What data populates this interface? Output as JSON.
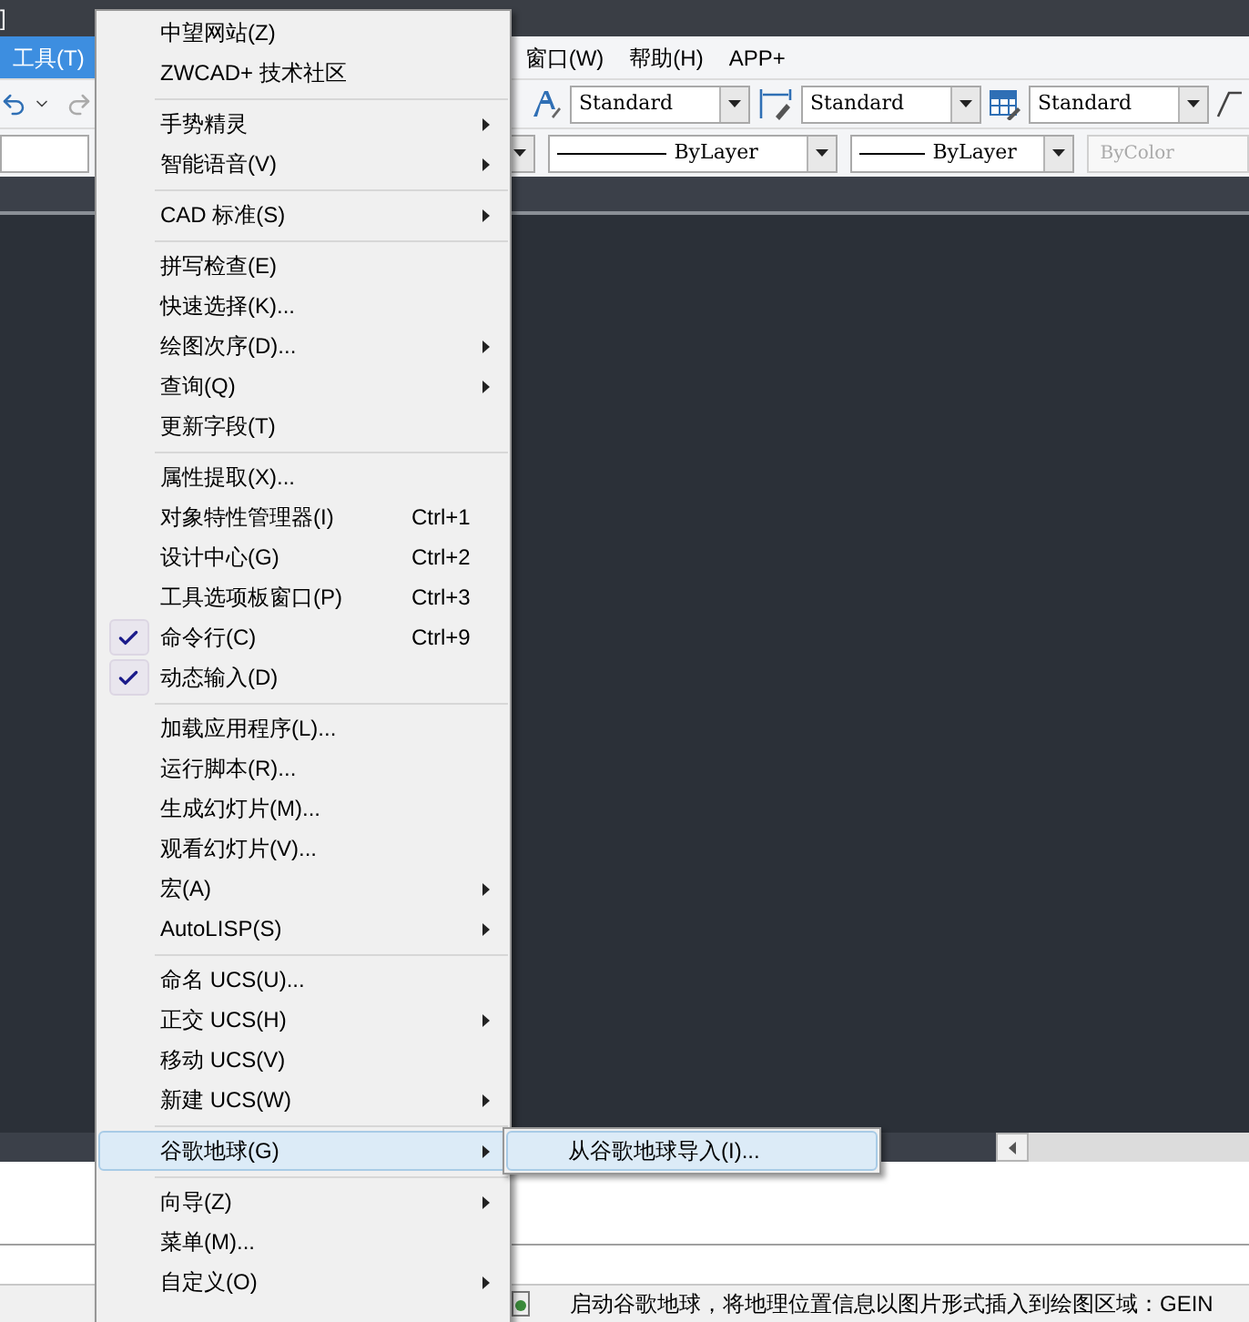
{
  "window": {
    "title": "]"
  },
  "menu_bar": {
    "items": [
      {
        "label": "工具(T)",
        "selected": true
      },
      {
        "label": "窗口(W)",
        "selected": false
      },
      {
        "label": "帮助(H)",
        "selected": false
      },
      {
        "label": "APP+",
        "selected": false
      }
    ]
  },
  "toolbar_1": {
    "combos": [
      {
        "kind": "text-style",
        "value": "Standard"
      },
      {
        "kind": "dimension-style",
        "value": "Standard"
      },
      {
        "kind": "table-style",
        "value": "Standard"
      }
    ]
  },
  "toolbar_2": {
    "combos": [
      {
        "kind": "linetype",
        "value": "ByLayer"
      },
      {
        "kind": "lineweight",
        "value": "ByLayer"
      }
    ],
    "color_field": {
      "value": "ByColor",
      "disabled": true
    }
  },
  "tools_menu": {
    "items": [
      {
        "kind": "item",
        "label": "中望网站(Z)",
        "checked": false,
        "selected": false,
        "submenu": false
      },
      {
        "kind": "item",
        "label": "ZWCAD+ 技术社区",
        "checked": false,
        "selected": false,
        "submenu": false
      },
      {
        "kind": "separator"
      },
      {
        "kind": "item",
        "label": "手势精灵",
        "checked": false,
        "selected": false,
        "submenu": true
      },
      {
        "kind": "item",
        "label": "智能语音(V)",
        "checked": false,
        "selected": false,
        "submenu": true
      },
      {
        "kind": "separator"
      },
      {
        "kind": "item",
        "label": "CAD 标准(S)",
        "checked": false,
        "selected": false,
        "submenu": true
      },
      {
        "kind": "separator"
      },
      {
        "kind": "item",
        "label": "拼写检查(E)",
        "checked": false,
        "selected": false,
        "submenu": false
      },
      {
        "kind": "item",
        "label": "快速选择(K)...",
        "checked": false,
        "selected": false,
        "submenu": false
      },
      {
        "kind": "item",
        "label": "绘图次序(D)...",
        "checked": false,
        "selected": false,
        "submenu": true
      },
      {
        "kind": "item",
        "label": "查询(Q)",
        "checked": false,
        "selected": false,
        "submenu": true
      },
      {
        "kind": "item",
        "label": "更新字段(T)",
        "checked": false,
        "selected": false,
        "submenu": false
      },
      {
        "kind": "separator"
      },
      {
        "kind": "item",
        "label": "属性提取(X)...",
        "checked": false,
        "selected": false,
        "submenu": false
      },
      {
        "kind": "item",
        "label": "对象特性管理器(I)",
        "shortcut": "Ctrl+1",
        "checked": false,
        "selected": false,
        "submenu": false
      },
      {
        "kind": "item",
        "label": "设计中心(G)",
        "shortcut": "Ctrl+2",
        "checked": false,
        "selected": false,
        "submenu": false
      },
      {
        "kind": "item",
        "label": "工具选项板窗口(P)",
        "shortcut": "Ctrl+3",
        "checked": false,
        "selected": false,
        "submenu": false
      },
      {
        "kind": "item",
        "label": "命令行(C)",
        "shortcut": "Ctrl+9",
        "checked": true,
        "selected": false,
        "submenu": false
      },
      {
        "kind": "item",
        "label": "动态输入(D)",
        "checked": true,
        "selected": false,
        "submenu": false
      },
      {
        "kind": "separator"
      },
      {
        "kind": "item",
        "label": "加载应用程序(L)...",
        "checked": false,
        "selected": false,
        "submenu": false
      },
      {
        "kind": "item",
        "label": "运行脚本(R)...",
        "checked": false,
        "selected": false,
        "submenu": false
      },
      {
        "kind": "item",
        "label": "生成幻灯片(M)...",
        "checked": false,
        "selected": false,
        "submenu": false
      },
      {
        "kind": "item",
        "label": "观看幻灯片(V)...",
        "checked": false,
        "selected": false,
        "submenu": false
      },
      {
        "kind": "item",
        "label": "宏(A)",
        "checked": false,
        "selected": false,
        "submenu": true
      },
      {
        "kind": "item",
        "label": "AutoLISP(S)",
        "checked": false,
        "selected": false,
        "submenu": true
      },
      {
        "kind": "separator"
      },
      {
        "kind": "item",
        "label": "命名 UCS(U)...",
        "checked": false,
        "selected": false,
        "submenu": false
      },
      {
        "kind": "item",
        "label": "正交 UCS(H)",
        "checked": false,
        "selected": false,
        "submenu": true
      },
      {
        "kind": "item",
        "label": "移动 UCS(V)",
        "checked": false,
        "selected": false,
        "submenu": false
      },
      {
        "kind": "item",
        "label": "新建 UCS(W)",
        "checked": false,
        "selected": false,
        "submenu": true
      },
      {
        "kind": "separator"
      },
      {
        "kind": "item",
        "label": "谷歌地球(G)",
        "checked": false,
        "selected": true,
        "submenu": true
      },
      {
        "kind": "separator"
      },
      {
        "kind": "item",
        "label": "向导(Z)",
        "checked": false,
        "selected": false,
        "submenu": true
      },
      {
        "kind": "item",
        "label": "菜单(M)...",
        "checked": false,
        "selected": false,
        "submenu": false
      },
      {
        "kind": "item",
        "label": "自定义(O)",
        "checked": false,
        "selected": false,
        "submenu": true
      }
    ]
  },
  "submenu": {
    "items": [
      {
        "label": "从谷歌地球导入(I)...",
        "selected": true
      }
    ]
  },
  "status_bar": {
    "text": "启动谷歌地球，将地理位置信息以图片形式插入到绘图区域：GEIN"
  }
}
